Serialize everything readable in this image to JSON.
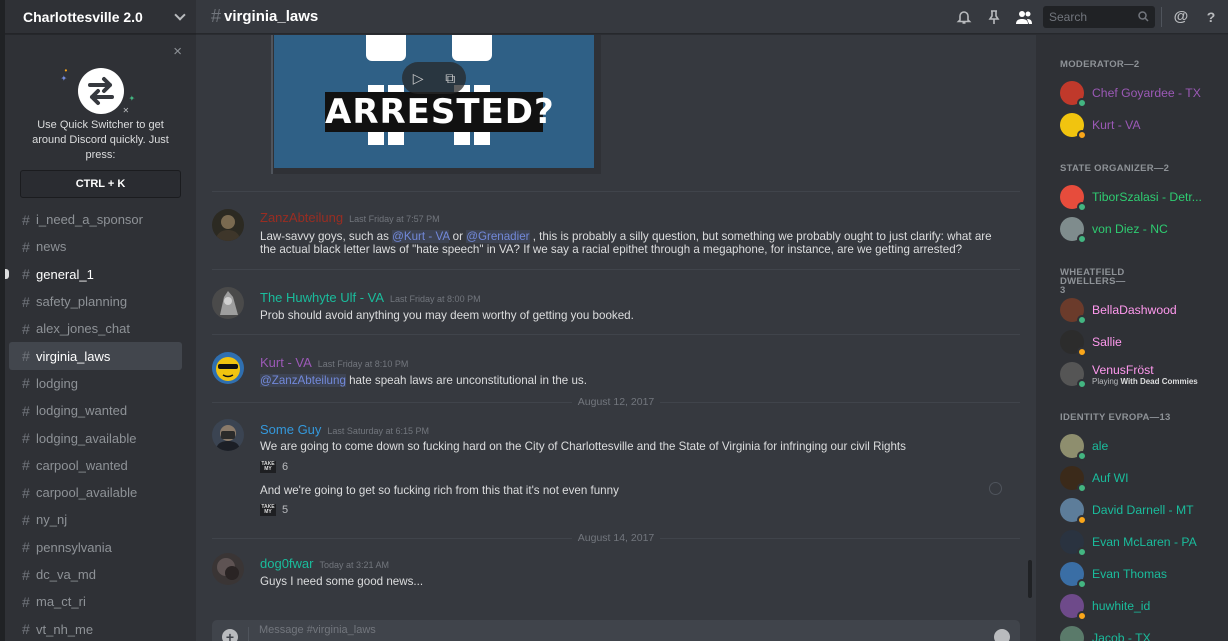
{
  "server": {
    "name": "Charlottesville 2.0"
  },
  "quick_switcher": {
    "text": "Use Quick Switcher to get around Discord quickly. Just press:",
    "shortcut": "CTRL + K",
    "close": "×"
  },
  "channels": [
    {
      "name": "i_need_a_sponsor",
      "state": "normal"
    },
    {
      "name": "news",
      "state": "normal"
    },
    {
      "name": "general_1",
      "state": "unread"
    },
    {
      "name": "safety_planning",
      "state": "normal"
    },
    {
      "name": "alex_jones_chat",
      "state": "normal"
    },
    {
      "name": "virginia_laws",
      "state": "active"
    },
    {
      "name": "lodging",
      "state": "normal"
    },
    {
      "name": "lodging_wanted",
      "state": "normal"
    },
    {
      "name": "lodging_available",
      "state": "normal"
    },
    {
      "name": "carpool_wanted",
      "state": "normal"
    },
    {
      "name": "carpool_available",
      "state": "normal"
    },
    {
      "name": "ny_nj",
      "state": "normal"
    },
    {
      "name": "pennsylvania",
      "state": "normal"
    },
    {
      "name": "dc_va_md",
      "state": "normal"
    },
    {
      "name": "ma_ct_ri",
      "state": "normal"
    },
    {
      "name": "vt_nh_me",
      "state": "normal"
    }
  ],
  "topbar": {
    "hash": "#",
    "channel": "virginia_laws",
    "search_placeholder": "Search",
    "at": "@",
    "help": "?"
  },
  "embed": {
    "banner": "ARRESTED?",
    "color": "#2f6086"
  },
  "messages": [
    {
      "author": "ZanzAbteilung",
      "color": "#992d22",
      "time": "Last Friday at 7:57 PM",
      "parts": [
        "Law-savvy goys, such as ",
        "@Kurt - VA",
        " or ",
        "@Grenadier",
        " , this is probably a silly question, but something we probably ought to just clarify: what are the actual black letter laws of \"hate speech\" in VA? If we say a racial epithet through a megaphone, for instance, are we getting arrested?"
      ]
    },
    {
      "author": "The Huwhyte Ulf - VA",
      "color": "#1abc9c",
      "time": "Last Friday at 8:00 PM",
      "text": "Prob should avoid anything you may deem worthy of getting you booked."
    },
    {
      "author": "Kurt - VA",
      "color": "#9b59b6",
      "time": "Last Friday at 8:10 PM",
      "mention": "@ZanzAbteilung",
      "text": " hate speah laws are unconstitutional in the us."
    },
    {
      "author": "Some Guy",
      "color": "#3498db",
      "time": "Last Saturday at 6:15 PM",
      "text": "We are going to come down so fucking hard on the City of Charlottesville and the State of Virginia for infringing our civil Rights",
      "reaction1": {
        "emoji": "TAKE MY",
        "count": "6"
      },
      "text2": "And we're going to get so fucking rich from this that it's not even funny",
      "reaction2": {
        "emoji": "TAKE MY",
        "count": "5"
      }
    },
    {
      "author": "dog0fwar",
      "color": "#1abc9c",
      "time": "Today at 3:21 AM",
      "text": "Guys I need some good news..."
    }
  ],
  "dividers": [
    "August 12, 2017",
    "August 14, 2017"
  ],
  "composer": {
    "placeholder": "Message #virginia_laws"
  },
  "members": {
    "categories": [
      {
        "title": "MODERATOR—2",
        "members": [
          {
            "name": "Chef Goyardee - TX",
            "color": "#9b59b6",
            "status": "online",
            "avatar": "#c0392b"
          },
          {
            "name": "Kurt - VA",
            "color": "#9b59b6",
            "status": "idle",
            "avatar": "#f1c40f"
          }
        ]
      },
      {
        "title": "STATE ORGANIZER—2",
        "members": [
          {
            "name": "TiborSzalasi - Detr...",
            "color": "#2ecc71",
            "status": "online",
            "avatar": "#e74c3c"
          },
          {
            "name": "von Diez - NC",
            "color": "#2ecc71",
            "status": "online",
            "avatar": "#7f8c8d"
          }
        ]
      },
      {
        "title": "WHEATFIELD DWELLERS—3",
        "members": [
          {
            "name": "BellaDashwood",
            "color": "#ff99ee",
            "status": "online",
            "avatar": "#6b3b2b"
          },
          {
            "name": "Sallie",
            "color": "#ff99ee",
            "status": "idle",
            "avatar": "#2c2c2c"
          },
          {
            "name": "VenusFröst",
            "color": "#ff99ee",
            "status": "online",
            "avatar": "#555555",
            "activity_prefix": "Playing",
            "activity": "With Dead Commies"
          }
        ]
      },
      {
        "title": "IDENTITY EVROPA—13",
        "members": [
          {
            "name": "ale",
            "color": "#1abc9c",
            "status": "online",
            "avatar": "#8e8e6e"
          },
          {
            "name": "Auf WI",
            "color": "#1abc9c",
            "status": "online",
            "avatar": "#3b2a1a"
          },
          {
            "name": "David Darnell - MT",
            "color": "#1abc9c",
            "status": "idle",
            "avatar": "#5d7d9a"
          },
          {
            "name": "Evan McLaren - PA",
            "color": "#1abc9c",
            "status": "online",
            "avatar": "#2a3340"
          },
          {
            "name": "Evan Thomas",
            "color": "#1abc9c",
            "status": "online",
            "avatar": "#3a6ea5"
          },
          {
            "name": "huwhite_id",
            "color": "#1abc9c",
            "status": "idle",
            "avatar": "#6e4a8a"
          },
          {
            "name": "Jacob - TX",
            "color": "#1abc9c",
            "status": "online",
            "avatar": "#5a7a6a"
          }
        ]
      }
    ]
  },
  "colors": {
    "online": "#43b581",
    "idle": "#faa61a",
    "mention": "#7289da"
  }
}
